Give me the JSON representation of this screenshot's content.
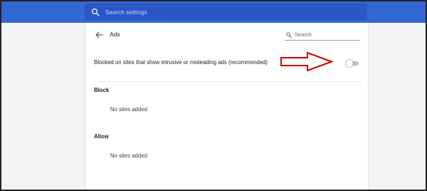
{
  "topbar": {
    "search_placeholder": "Search settings"
  },
  "page": {
    "title": "Ads",
    "search_placeholder": "Search"
  },
  "setting": {
    "label": "Blocked on sites that show intrusive or misleading ads (recommended)",
    "toggle_on": false
  },
  "block": {
    "heading": "Block",
    "empty_text": "No sites added"
  },
  "allow": {
    "heading": "Allow",
    "empty_text": "No sites added"
  },
  "colors": {
    "toolbar": "#3367d6",
    "search_field": "#2a56c6",
    "annotation_arrow": "#cc0000"
  },
  "icons": {
    "toolbar_search": "search-icon",
    "back": "back-arrow-icon",
    "page_search": "search-icon",
    "annotation": "right-arrow-annotation"
  }
}
